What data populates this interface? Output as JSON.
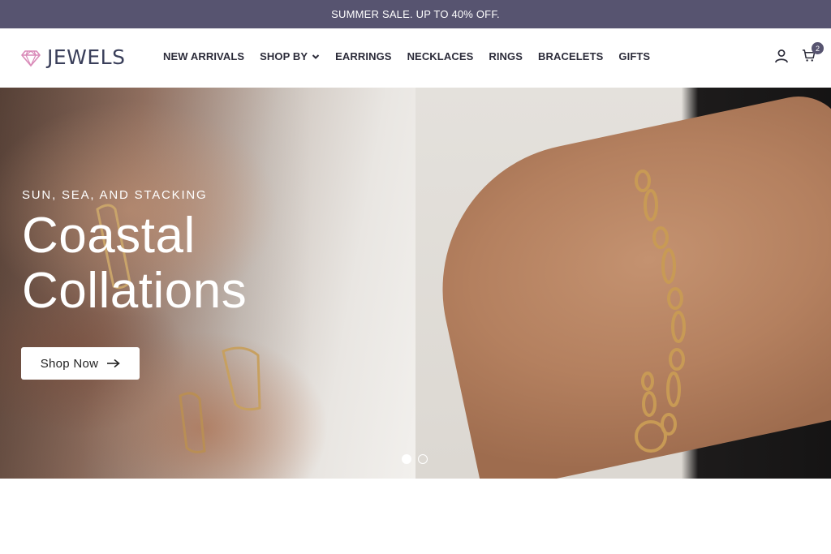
{
  "promo": {
    "text": "SUMMER SALE. UP TO 40% OFF."
  },
  "header": {
    "logo_text": "JEWELS",
    "logo_icon": "diamond-icon",
    "nav": [
      {
        "label": "NEW ARRIVALS"
      },
      {
        "label": "SHOP BY",
        "icon": "chevron-down-icon"
      },
      {
        "label": "EARRINGS"
      },
      {
        "label": "NECKLACES"
      },
      {
        "label": "RINGS"
      },
      {
        "label": "BRACELETS"
      },
      {
        "label": "GIFTS"
      }
    ],
    "account_icon": "user-icon",
    "cart_icon": "cart-icon",
    "cart_count": "2"
  },
  "hero": {
    "eyebrow": "SUN, SEA, AND STACKING",
    "headline_line1": "Coastal",
    "headline_line2": "Collations",
    "cta_label": "Shop Now",
    "cta_icon": "arrow-right-icon",
    "slides_total": 2,
    "active_slide": 1
  },
  "colors": {
    "promo_bg": "#575470",
    "logo_accent": "#d98ab8",
    "text_dark": "#2c2c3a"
  }
}
